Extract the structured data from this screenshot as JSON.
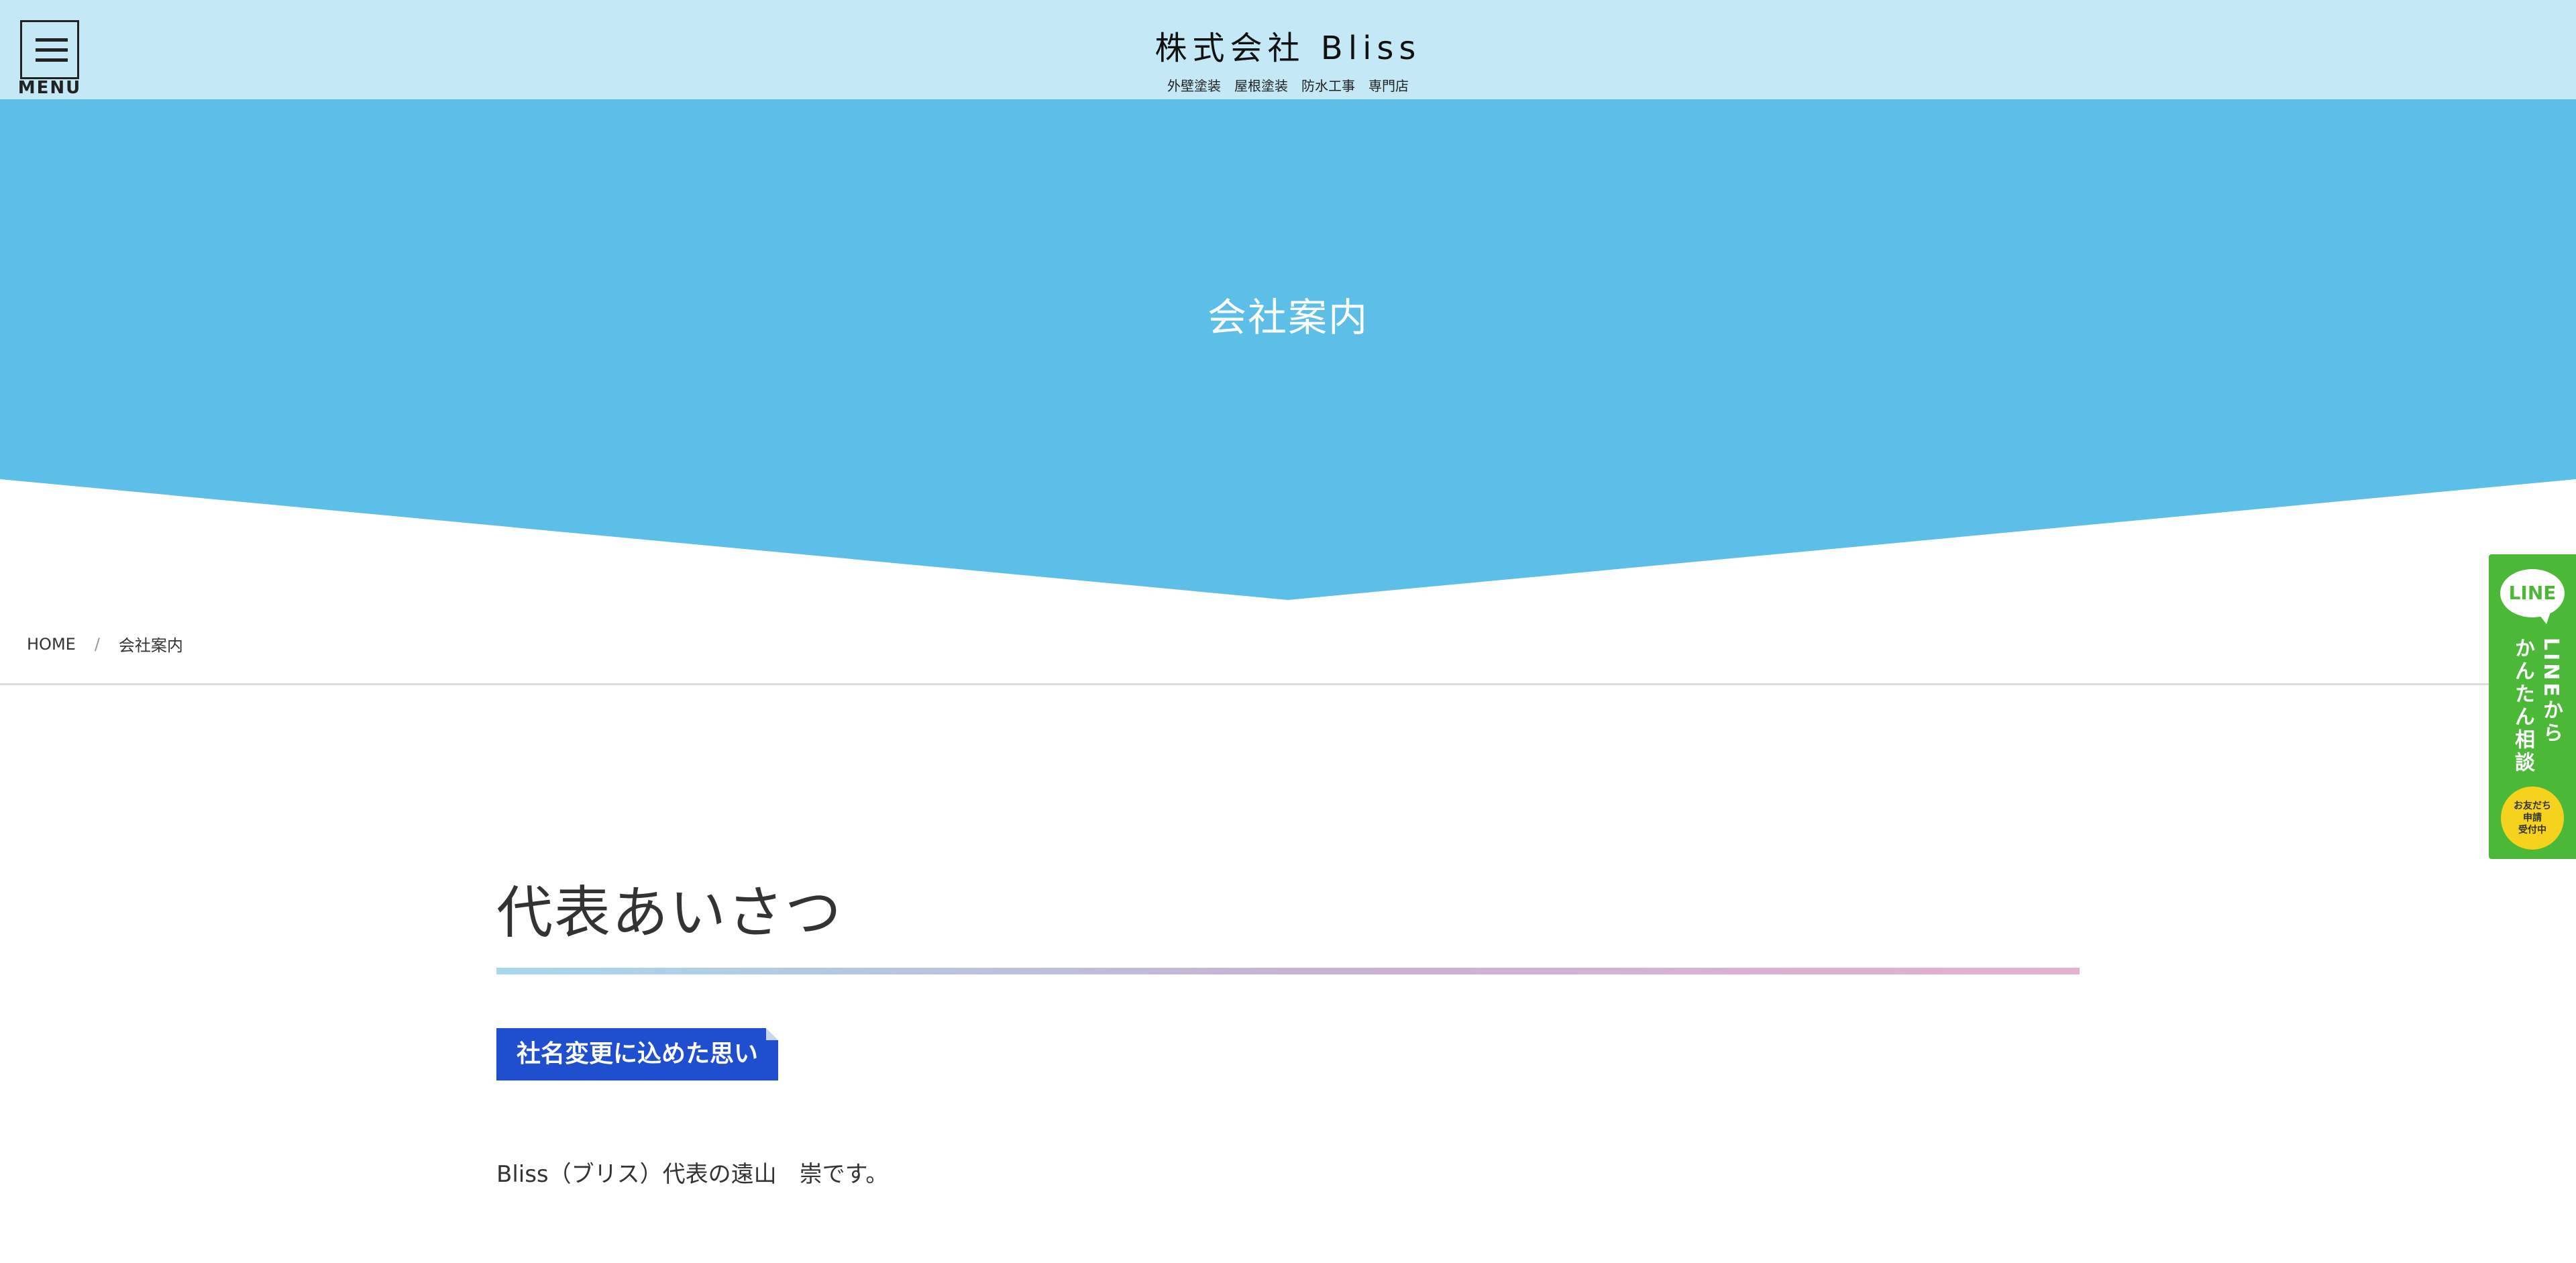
{
  "header": {
    "menu_label": "MENU",
    "brand_name": "株式会社 Bliss",
    "brand_tagline": "外壁塗装　屋根塗装　防水工事　専門店"
  },
  "hero": {
    "title": "会社案内",
    "color": "#5dbfe7"
  },
  "breadcrumb": {
    "home": "HOME",
    "separator": "/",
    "current": "会社案内"
  },
  "content": {
    "section_title": "代表あいさつ",
    "label": "社名変更に込めた思い",
    "intro": "Bliss（ブリス）代表の遠山　崇です。"
  },
  "line_tab": {
    "logo": "LINE",
    "line1": "LINEから",
    "line2": "かんたん相談",
    "badge_line1": "お友だち",
    "badge_line2": "申請",
    "badge_line3": "受付中",
    "color": "#4cb838"
  }
}
